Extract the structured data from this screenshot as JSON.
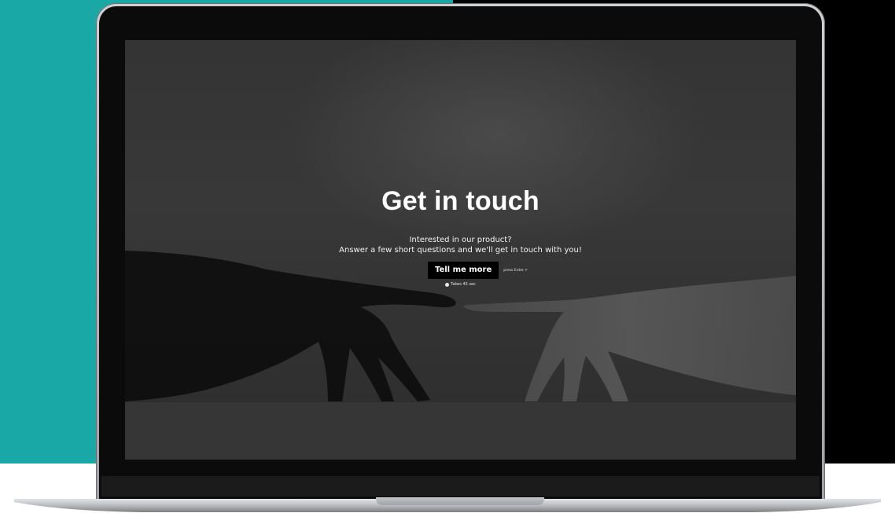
{
  "colors": {
    "left_background": "#19a8a6",
    "right_background": "#000000",
    "screen_background": "#373737",
    "button_background": "#000000",
    "text": "#ffffff"
  },
  "page": {
    "title": "Get in touch",
    "subtitle_line_1": "Interested in our product?",
    "subtitle_line_2": "Answer a few short questions and we'll get in touch with you!",
    "cta_label": "Tell me more",
    "enter_hint": "press Enter ↵",
    "time_estimate": "Takes 45 sec",
    "icons": {
      "timing": "clock-icon"
    }
  }
}
